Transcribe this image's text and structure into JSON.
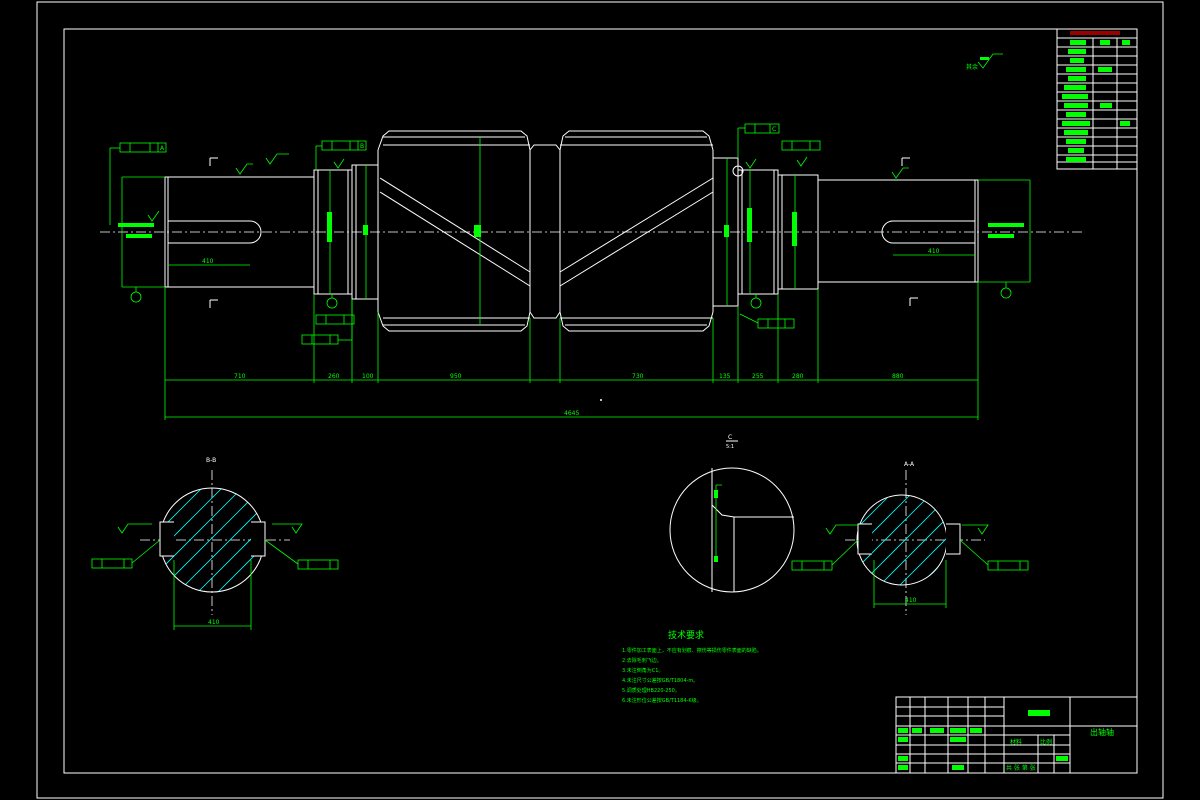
{
  "drawing": {
    "title_block": {
      "part_name": "出轴轴",
      "scale_label": "比例",
      "material_label": "材料",
      "sheet_label": "共 张 第 张"
    },
    "notes": {
      "heading": "技术要求",
      "items": [
        "1.零件加工表面上，不应有划痕、擦伤等损伤零件表面的缺陷。",
        "2.去除毛刺飞边。",
        "3.未注倒角为C1。",
        "4.未注尺寸公差按GB/T1804-m。",
        "5.调质处理HB220-250。",
        "6.未注形位公差按GB/T1184-K级。"
      ]
    },
    "dimensions": {
      "d1": "710",
      "d2": "260",
      "d3": "100",
      "d4": "950",
      "d5": "730",
      "d6": "135",
      "d7": "255",
      "d8": "280",
      "d9": "880",
      "overall": "4645",
      "key_left": "410",
      "key_right": "410",
      "sec_left_width": "410",
      "sec_right_width": "410"
    },
    "views": {
      "section_b": "B-B",
      "section_a": "A-A",
      "detail_c": "C",
      "detail_scale": "5:1"
    },
    "datums": [
      "A",
      "B",
      "C"
    ],
    "datum_labels_left": "B",
    "datum_labels_right": "B",
    "roughness_note": "其余"
  }
}
